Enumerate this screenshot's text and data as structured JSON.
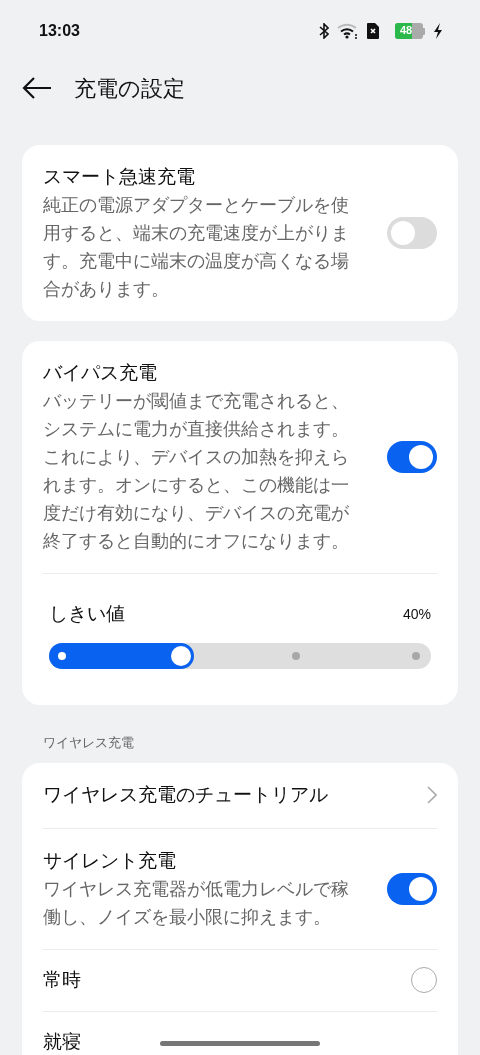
{
  "status_bar": {
    "time": "13:03",
    "battery": "48"
  },
  "header": {
    "title": "充電の設定"
  },
  "cards": [
    {
      "items": [
        {
          "kind": "toggle",
          "title": "スマート急速充電",
          "description": "純正の電源アダプターとケーブルを使用すると、端末の充電速度が上がります。充電中に端末の温度が高くなる場合があります。",
          "on": false
        }
      ]
    },
    {
      "items": [
        {
          "kind": "toggle",
          "title": "バイパス充電",
          "description": "バッテリーが閾値まで充電されると、システムに電力が直接供給されます。これにより、デバイスの加熱を抑えられます。オンにすると、この機能は一度だけ有効になり、デバイスの充電が終了すると自動的にオフになります。",
          "on": true
        },
        {
          "kind": "slider",
          "title": "しきい値",
          "reading": "40%",
          "level": 0.38
        }
      ]
    },
    {
      "section": "ワイヤレス充電",
      "items": [
        {
          "kind": "link",
          "title": "ワイヤレス充電のチュートリアル"
        },
        {
          "kind": "toggle",
          "title": "サイレント充電",
          "description": "ワイヤレス充電器が低電力レベルで稼働し、ノイズを最小限に抑えます。",
          "on": true
        },
        {
          "kind": "radio",
          "title": "常時",
          "selected": false
        },
        {
          "kind": "radio",
          "title": "就寝"
        }
      ]
    }
  ]
}
